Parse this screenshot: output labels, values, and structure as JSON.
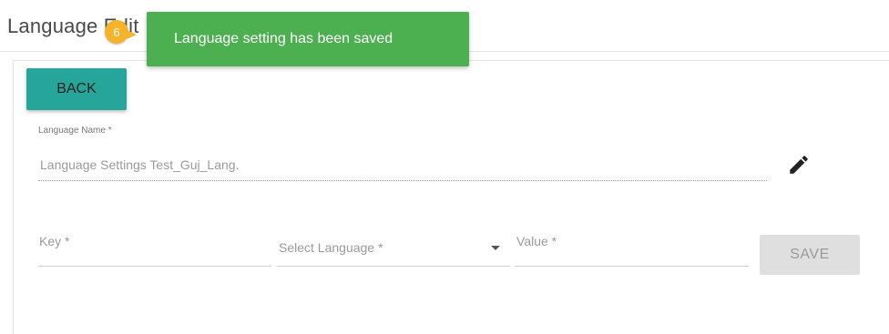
{
  "page": {
    "title": "Language Edit"
  },
  "step_badge": {
    "number": "6",
    "color": "#f4b329"
  },
  "toast": {
    "message": "Language setting has been saved",
    "color": "#4caf50"
  },
  "buttons": {
    "back_label": "BACK",
    "back_color": "#26a69a",
    "save_label": "SAVE"
  },
  "language_name": {
    "label": "Language Name *",
    "value": "Language Settings Test_Guj_Lang.",
    "edit_icon": "pencil-icon"
  },
  "fields": {
    "key_placeholder": "Key *",
    "select_language_placeholder": "Select Language *",
    "value_placeholder": "Value *"
  }
}
